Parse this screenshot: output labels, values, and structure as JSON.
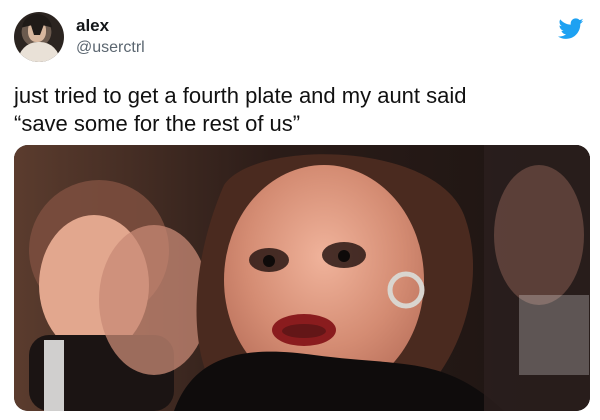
{
  "tweet": {
    "user": {
      "display_name": "alex",
      "handle": "@userctrl",
      "avatar_icon": "profile-photo"
    },
    "platform_icon": "twitter-bird-icon",
    "text_line1": "just tried to get a fourth plate and my aunt said",
    "text_line2": "“save some for the rest of us”",
    "media": {
      "icon": "photo-icon"
    }
  },
  "colors": {
    "twitter_blue": "#1da1f2",
    "text": "#111111",
    "handle_gray": "#5b6670"
  }
}
